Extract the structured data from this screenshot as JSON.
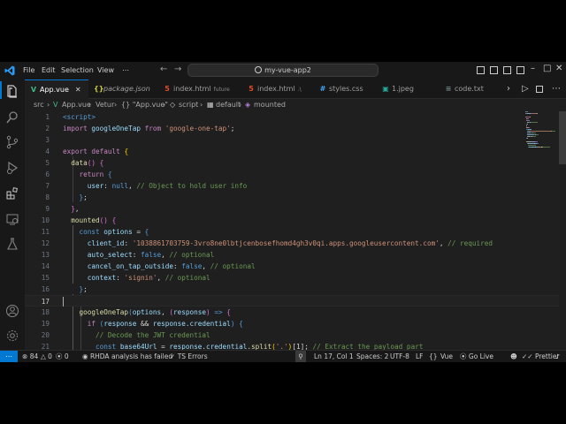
{
  "menu": [
    "File",
    "Edit",
    "Selection",
    "View",
    "⋯"
  ],
  "search": {
    "label": "my-vue-app2"
  },
  "tabs": [
    {
      "label": "App.vue",
      "icon": "vue-icon",
      "color": "#41b883",
      "italic": false,
      "desc": ""
    },
    {
      "label": "package.json",
      "icon": "json-icon",
      "color": "#cbcb41",
      "italic": true,
      "desc": ""
    },
    {
      "label": "index.html",
      "icon": "html-icon",
      "color": "#e44d26",
      "italic": false,
      "desc": "future"
    },
    {
      "label": "index.html",
      "icon": "html-icon",
      "color": "#e44d26",
      "italic": false,
      "desc": ".\\"
    },
    {
      "label": "styles.css",
      "icon": "css-icon",
      "color": "#42a5f5",
      "italic": false,
      "desc": ""
    },
    {
      "label": "1.jpeg",
      "icon": "image-icon",
      "color": "#26a69a",
      "italic": false,
      "desc": ""
    },
    {
      "label": "code.txt",
      "icon": "text-file-icon",
      "color": "#6d8086",
      "italic": false,
      "desc": ""
    }
  ],
  "breadcrumb": [
    "src",
    "›",
    "App.vue",
    "›",
    "Vetur",
    "›",
    "{} \"App.vue\"",
    "›",
    "script",
    "›",
    "default",
    "›",
    "mounted"
  ],
  "code_lines": [
    {
      "n": "1",
      "t": [
        [
          "t",
          "<script>"
        ]
      ]
    },
    {
      "n": "2",
      "t": [
        [
          "c",
          "import "
        ],
        [
          "v",
          "googleOneTap "
        ],
        [
          "c",
          "from "
        ],
        [
          "s",
          "'google-one-tap'"
        ],
        [
          "w",
          ";"
        ]
      ]
    },
    {
      "n": "3",
      "t": []
    },
    {
      "n": "4",
      "t": [
        [
          "c",
          "export "
        ],
        [
          "c",
          "default "
        ],
        [
          "p",
          "{"
        ]
      ]
    },
    {
      "n": "5",
      "t": [
        [
          "w",
          "  "
        ],
        [
          "f",
          "data"
        ],
        [
          "m",
          "() "
        ],
        [
          "m",
          "{"
        ]
      ]
    },
    {
      "n": "6",
      "t": [
        [
          "w",
          "    "
        ],
        [
          "c",
          "return "
        ],
        [
          "k",
          "{"
        ]
      ]
    },
    {
      "n": "7",
      "t": [
        [
          "w",
          "      "
        ],
        [
          "v",
          "user"
        ],
        [
          "w",
          ": "
        ],
        [
          "k",
          "null"
        ],
        [
          "w",
          ", "
        ],
        [
          "cm",
          "// Object to hold user info"
        ]
      ]
    },
    {
      "n": "8",
      "t": [
        [
          "w",
          "    "
        ],
        [
          "k",
          "}"
        ],
        [
          "w",
          ";"
        ]
      ]
    },
    {
      "n": "9",
      "t": [
        [
          "w",
          "  "
        ],
        [
          "m",
          "}"
        ],
        [
          "w",
          ","
        ]
      ]
    },
    {
      "n": "10",
      "t": [
        [
          "w",
          "  "
        ],
        [
          "f",
          "mounted"
        ],
        [
          "m",
          "() "
        ],
        [
          "m",
          "{"
        ]
      ]
    },
    {
      "n": "11",
      "t": [
        [
          "w",
          "    "
        ],
        [
          "k",
          "const "
        ],
        [
          "v",
          "options "
        ],
        [
          "w",
          "= "
        ],
        [
          "k",
          "{"
        ]
      ]
    },
    {
      "n": "12",
      "t": [
        [
          "w",
          "      "
        ],
        [
          "v",
          "client_id"
        ],
        [
          "w",
          ": "
        ],
        [
          "s",
          "'1038861703759-3vro8ne0lbtjcenbosefhomd4gh3v0qi.apps.googleusercontent.com'"
        ],
        [
          "w",
          ", "
        ],
        [
          "cm",
          "// required"
        ]
      ]
    },
    {
      "n": "13",
      "t": [
        [
          "w",
          "      "
        ],
        [
          "v",
          "auto_select"
        ],
        [
          "w",
          ": "
        ],
        [
          "k",
          "false"
        ],
        [
          "w",
          ", "
        ],
        [
          "cm",
          "// optional"
        ]
      ]
    },
    {
      "n": "14",
      "t": [
        [
          "w",
          "      "
        ],
        [
          "v",
          "cancel_on_tap_outside"
        ],
        [
          "w",
          ": "
        ],
        [
          "k",
          "false"
        ],
        [
          "w",
          ", "
        ],
        [
          "cm",
          "// optional"
        ]
      ]
    },
    {
      "n": "15",
      "t": [
        [
          "w",
          "      "
        ],
        [
          "v",
          "context"
        ],
        [
          "w",
          ": "
        ],
        [
          "s",
          "'signin'"
        ],
        [
          "w",
          ", "
        ],
        [
          "cm",
          "// optional"
        ]
      ]
    },
    {
      "n": "16",
      "t": [
        [
          "w",
          "    "
        ],
        [
          "k",
          "}"
        ],
        [
          "w",
          ";"
        ]
      ]
    },
    {
      "n": "17",
      "t": []
    },
    {
      "n": "18",
      "t": [
        [
          "w",
          "    "
        ],
        [
          "f",
          "googleOneTap"
        ],
        [
          "k",
          "("
        ],
        [
          "v",
          "options"
        ],
        [
          "w",
          ", "
        ],
        [
          "m",
          "("
        ],
        [
          "v",
          "response"
        ],
        [
          "m",
          ") "
        ],
        [
          "k",
          "=> "
        ],
        [
          "m",
          "{"
        ]
      ]
    },
    {
      "n": "19",
      "t": [
        [
          "w",
          "      "
        ],
        [
          "c",
          "if "
        ],
        [
          "k",
          "("
        ],
        [
          "v",
          "response "
        ],
        [
          "w",
          "&& "
        ],
        [
          "v",
          "response"
        ],
        [
          "w",
          "."
        ],
        [
          "v",
          "credential"
        ],
        [
          "k",
          ") "
        ],
        [
          "k",
          "{"
        ]
      ]
    },
    {
      "n": "20",
      "t": [
        [
          "w",
          "        "
        ],
        [
          "cm",
          "// Decode the JWT credential"
        ]
      ]
    },
    {
      "n": "21",
      "t": [
        [
          "w",
          "        "
        ],
        [
          "k",
          "const "
        ],
        [
          "v",
          "base64Url "
        ],
        [
          "w",
          "= "
        ],
        [
          "v",
          "response"
        ],
        [
          "w",
          "."
        ],
        [
          "v",
          "credential"
        ],
        [
          "w",
          "."
        ],
        [
          "f",
          "split"
        ],
        [
          "p",
          "("
        ],
        [
          "s",
          "'.'"
        ],
        [
          "p",
          ")"
        ],
        [
          "w",
          "["
        ],
        [
          "w",
          "1"
        ],
        [
          "w",
          "]; "
        ],
        [
          "cm",
          "// Extract the payload part"
        ]
      ]
    }
  ],
  "status": {
    "problems": "84",
    "warnings": "0",
    "ports": "0",
    "rhda": "RHDA analysis has failed",
    "ts": "TS Errors",
    "position": "Ln 17, Col 1",
    "spaces": "Spaces: 2",
    "encoding": "UTF-8",
    "eol": "LF",
    "braces": "{}",
    "language": "Vue",
    "golive": "Go Live",
    "prettier": "Prettier"
  },
  "colors": {
    "accent": "#0078d4",
    "background": "#1f1f1f",
    "sidebar": "#181818"
  }
}
